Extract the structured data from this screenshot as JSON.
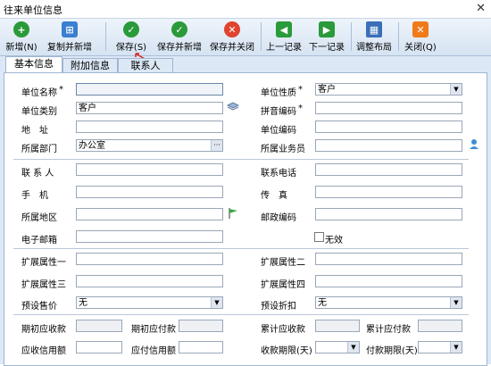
{
  "window": {
    "title": "往来单位信息",
    "close": "✕"
  },
  "toolbar": [
    {
      "label": "新增(N)",
      "icon": "plus-icon",
      "color": "#2a9a3a",
      "glyph": "+"
    },
    {
      "label": "复制并新增",
      "icon": "copy-icon",
      "color": "#3a7fd0",
      "glyph": "⊞"
    },
    {
      "label": "保存(S)",
      "icon": "check-icon",
      "color": "#2a9a3a",
      "glyph": "✓"
    },
    {
      "label": "保存并新增",
      "icon": "double-check-icon",
      "color": "#2a9a3a",
      "glyph": "✓"
    },
    {
      "label": "保存并关闭",
      "icon": "cancel-icon",
      "color": "#e0432f",
      "glyph": "✕"
    },
    {
      "label": "上一记录",
      "icon": "prev-icon",
      "color": "#2a9a3a",
      "glyph": "◀"
    },
    {
      "label": "下一记录",
      "icon": "next-icon",
      "color": "#2a9a3a",
      "glyph": "▶"
    },
    {
      "label": "调整布局",
      "icon": "grid-icon",
      "color": "#3a6fb8",
      "glyph": "▦"
    },
    {
      "label": "关闭(Q)",
      "icon": "close-icon",
      "color": "#f07a1a",
      "glyph": "✕"
    }
  ],
  "tabs": [
    "基本信息",
    "附加信息",
    "联系人"
  ],
  "form": {
    "unit_name": {
      "label": "单位名称",
      "value": ""
    },
    "unit_nature": {
      "label": "单位性质",
      "value": "客户"
    },
    "unit_category": {
      "label": "单位类别",
      "value": "客户"
    },
    "pinyin_code": {
      "label": "拼音编码",
      "value": ""
    },
    "address": {
      "label": "地　址",
      "value": ""
    },
    "unit_code": {
      "label": "单位编码",
      "value": ""
    },
    "department": {
      "label": "所属部门",
      "value": "办公室"
    },
    "salesperson": {
      "label": "所属业务员",
      "value": ""
    },
    "contact": {
      "label": "联 系 人",
      "value": ""
    },
    "phone": {
      "label": "联系电话",
      "value": ""
    },
    "mobile": {
      "label": "手　机",
      "value": ""
    },
    "fax": {
      "label": "传　真",
      "value": ""
    },
    "region": {
      "label": "所属地区",
      "value": ""
    },
    "postcode": {
      "label": "邮政编码",
      "value": ""
    },
    "email": {
      "label": "电子邮箱",
      "value": ""
    },
    "invalid": {
      "label": "无效"
    },
    "ext1": {
      "label": "扩展属性一",
      "value": ""
    },
    "ext2": {
      "label": "扩展属性二",
      "value": ""
    },
    "ext3": {
      "label": "扩展属性三",
      "value": ""
    },
    "ext4": {
      "label": "扩展属性四",
      "value": ""
    },
    "preset_price": {
      "label": "预设售价",
      "value": "无"
    },
    "preset_discount": {
      "label": "预设折扣",
      "value": "无"
    },
    "init_receivable": {
      "label": "期初应收款",
      "value": ""
    },
    "init_payable": {
      "label": "期初应付款",
      "value": ""
    },
    "acc_receivable": {
      "label": "累计应收款",
      "value": ""
    },
    "acc_payable": {
      "label": "累计应付款",
      "value": ""
    },
    "recv_credit": {
      "label": "应收信用额",
      "value": ""
    },
    "pay_credit": {
      "label": "应付信用额",
      "value": ""
    },
    "recv_term": {
      "label": "收款期限(天)",
      "value": ""
    },
    "pay_term": {
      "label": "付款期限(天)",
      "value": ""
    }
  }
}
